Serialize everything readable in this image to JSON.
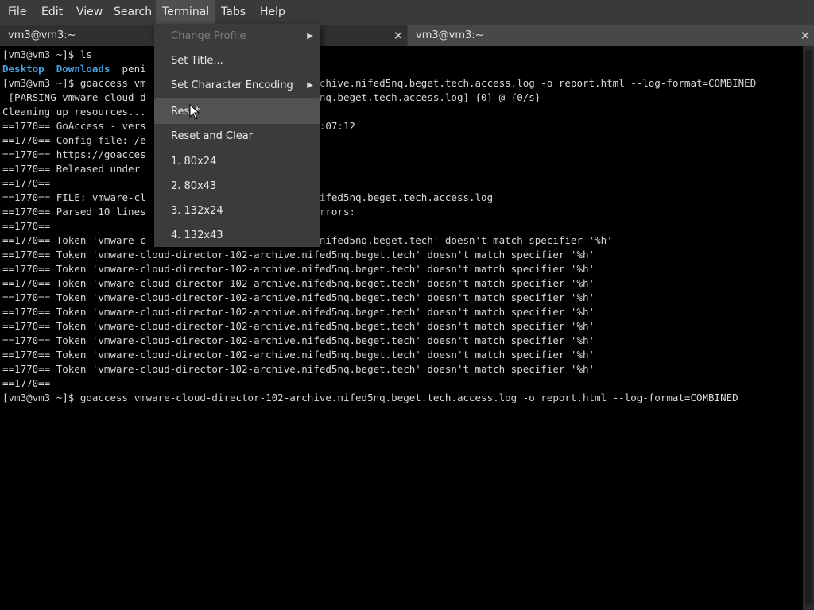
{
  "menubar": {
    "items": [
      "File",
      "Edit",
      "View",
      "Search",
      "Terminal",
      "Tabs",
      "Help"
    ],
    "active": "Terminal"
  },
  "tabs": [
    {
      "label": "vm3@vm3:~",
      "active": true
    },
    {
      "label": "vm3@vm3:~",
      "active": false
    }
  ],
  "terminal_menu": {
    "items": [
      {
        "label": "Change Profile",
        "disabled": true,
        "submenu": true
      },
      {
        "label": "Set Title...",
        "disabled": false,
        "submenu": false
      },
      {
        "label": "Set Character Encoding",
        "disabled": false,
        "submenu": true
      },
      {
        "label": "Reset",
        "disabled": false,
        "submenu": false,
        "hover": true
      },
      {
        "label": "Reset and Clear",
        "disabled": false,
        "submenu": false
      },
      {
        "label": "1. 80x24"
      },
      {
        "label": "2. 80x43"
      },
      {
        "label": "3. 132x24"
      },
      {
        "label": "4. 132x43"
      }
    ]
  },
  "terminal": {
    "lines": [
      "[vm3@vm3 ~]$ ls",
      "Desktop  Downloads  peni",
      "[vm3@vm3 ~]$ goaccess vm                             chive.nifed5nq.beget.tech.access.log -o report.html --log-format=COMBINED",
      " [PARSING vmware-cloud-d                             nq.beget.tech.access.log] {0} @ {0/s}",
      "Cleaning up resources...",
      "==1770== GoAccess - vers                             :07:12",
      "==1770== Config file: /e",
      "==1770== https://goacces",
      "==1770== Released under",
      "==1770==",
      "==1770== FILE: vmware-cl                             ifed5nq.beget.tech.access.log",
      "==1770== Parsed 10 lines                             rrors:",
      "==1770==",
      "==1770== Token 'vmware-c                             nifed5nq.beget.tech' doesn't match specifier '%h'",
      "==1770== Token 'vmware-cloud-director-102-archive.nifed5nq.beget.tech' doesn't match specifier '%h'",
      "==1770== Token 'vmware-cloud-director-102-archive.nifed5nq.beget.tech' doesn't match specifier '%h'",
      "==1770== Token 'vmware-cloud-director-102-archive.nifed5nq.beget.tech' doesn't match specifier '%h'",
      "==1770== Token 'vmware-cloud-director-102-archive.nifed5nq.beget.tech' doesn't match specifier '%h'",
      "==1770== Token 'vmware-cloud-director-102-archive.nifed5nq.beget.tech' doesn't match specifier '%h'",
      "==1770== Token 'vmware-cloud-director-102-archive.nifed5nq.beget.tech' doesn't match specifier '%h'",
      "==1770== Token 'vmware-cloud-director-102-archive.nifed5nq.beget.tech' doesn't match specifier '%h'",
      "==1770== Token 'vmware-cloud-director-102-archive.nifed5nq.beget.tech' doesn't match specifier '%h'",
      "==1770== Token 'vmware-cloud-director-102-archive.nifed5nq.beget.tech' doesn't match specifier '%h'",
      "==1770==",
      "[vm3@vm3 ~]$ goaccess vmware-cloud-director-102-archive.nifed5nq.beget.tech.access.log -o report.html --log-format=COMBINED"
    ]
  },
  "colors": {
    "directory": "#4aa3df",
    "text": "#d8d8d8",
    "background": "#000000",
    "menu_bg": "#3b3b3b"
  },
  "icons": {
    "submenu_arrow": "triangle-right-icon",
    "tab_close": "close-icon",
    "pointer": "mouse-cursor-icon"
  }
}
